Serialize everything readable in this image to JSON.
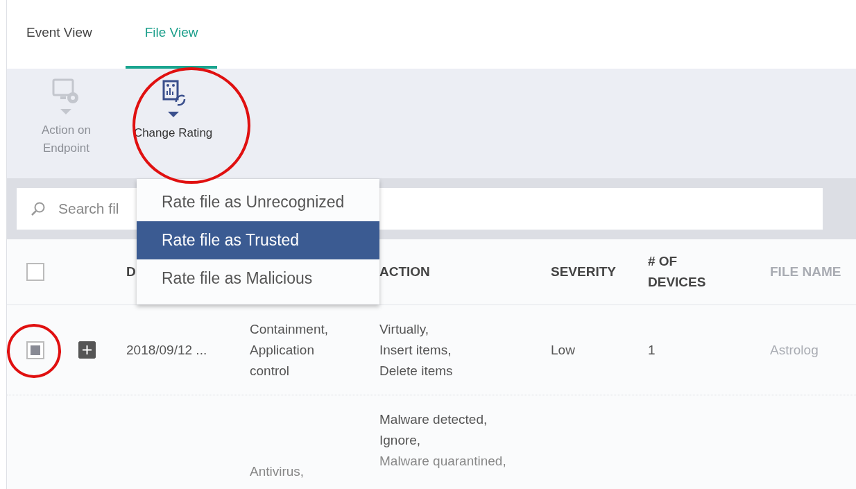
{
  "tabs": [
    {
      "label": "Event View",
      "selected": false
    },
    {
      "label": "File View",
      "selected": true
    }
  ],
  "toolbar": [
    {
      "kind": "endpoint",
      "label": "Action on\nEndpoint",
      "disabled": true
    },
    {
      "kind": "rating",
      "label": "Change Rating",
      "disabled": false
    }
  ],
  "search": {
    "placeholder": "Search fil"
  },
  "dropdown": {
    "items": [
      {
        "label": "Rate file as Unrecognized",
        "selected": false
      },
      {
        "label": "Rate file as Trusted",
        "selected": true
      },
      {
        "label": "Rate file as Malicious",
        "selected": false
      }
    ]
  },
  "table": {
    "header_checkbox": {
      "checked": false
    },
    "columns": [
      {
        "label": "D"
      },
      {
        "label": "ACTION"
      },
      {
        "label": "SEVERITY"
      },
      {
        "label": "# OF\nDEVICES"
      },
      {
        "label": "FILE NAME"
      }
    ],
    "rows": [
      {
        "checked": true,
        "expanded": false,
        "date": "2018/09/12 ...",
        "detection": "Containment,\nApplication\ncontrol",
        "action": [
          "Virtually,",
          "Insert items,",
          "Delete items"
        ],
        "severity": "Low",
        "devices": "1",
        "file_name": "Astrolog"
      },
      {
        "detection": "Antivirus,",
        "action": [
          "Malware detected,",
          "Ignore,",
          "Malware quarantined,"
        ]
      }
    ]
  }
}
